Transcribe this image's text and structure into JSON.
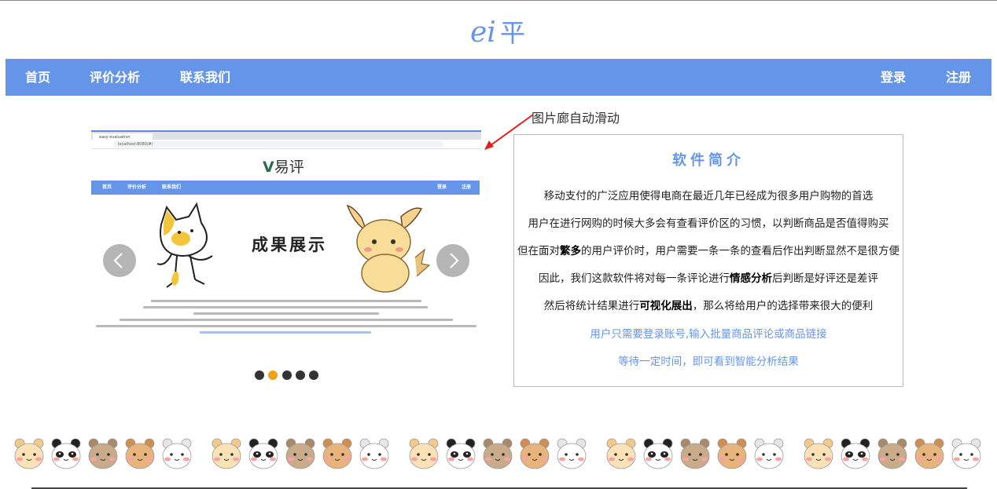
{
  "logo": {
    "text_prefix": "ei",
    "text_suffix": "平"
  },
  "nav": {
    "left": [
      "首页",
      "评价分析",
      "联系我们"
    ],
    "right": [
      "登录",
      "注册"
    ]
  },
  "annotation": "图片廊自动滑动",
  "carousel": {
    "active_index": 1,
    "dot_count": 5,
    "slide": {
      "browser_tab_label": "easy evaluation",
      "address": "localhost:8080/#/",
      "logo_text": "易评",
      "nav_left": [
        "首页",
        "评价分析",
        "联系我们"
      ],
      "nav_right": [
        "登录",
        "注册"
      ],
      "banner_text": "成果展示"
    }
  },
  "intro": {
    "title": "软件简介",
    "line1": "移动支付的广泛应用使得电商在最近几年已经成为很多用户购物的首选",
    "line2": "用户在进行网购的时候大多会有查看评价区的习惯，以判断商品是否值得购买",
    "line3_a": "但在面对",
    "line3_b": "繁多",
    "line3_c": "的用户评价时，用户需要一条一条的查看后作出判断显然不是很方便",
    "line4_a": "因此，我们这款软件将对每一条评论进行",
    "line4_b": "情感分析",
    "line4_c": "后判断是好评还是差评",
    "line5_a": "然后将统计结果进行",
    "line5_b": "可视化展出",
    "line5_c": "，那么将给用户的选择带来很大的便利",
    "line6": "用户只需要登录账号,输入批量商品评论或商品链接",
    "line7": "等待一定时间，即可看到智能分析结果"
  },
  "colors": {
    "accent": "#6595e8",
    "dot_active": "#f0a11a",
    "dot_inactive": "#333333"
  }
}
